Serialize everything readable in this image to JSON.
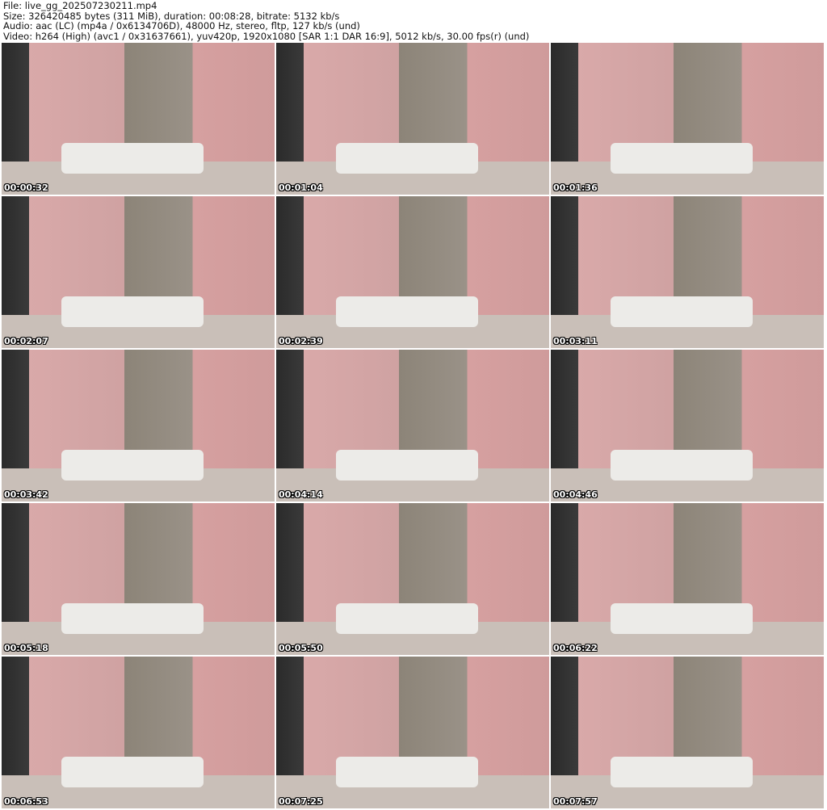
{
  "header": {
    "file": "File: live_gg_202507230211.mp4",
    "size": "Size: 326420485 bytes (311 MiB), duration: 00:08:28, bitrate: 5132 kb/s",
    "audio": "Audio: aac (LC) (mp4a / 0x6134706D), 48000 Hz, stereo, fltp, 127 kb/s (und)",
    "video": "Video: h264 (High) (avc1 / 0x31637661), yuv420p, 1920x1080 [SAR 1:1 DAR 16:9], 5012 kb/s, 30.00 fps(r) (und)"
  },
  "thumbnails": [
    "00:00:32",
    "00:01:04",
    "00:01:36",
    "00:02:07",
    "00:02:39",
    "00:03:11",
    "00:03:42",
    "00:04:14",
    "00:04:46",
    "00:05:18",
    "00:05:50",
    "00:06:22",
    "00:06:53",
    "00:07:25",
    "00:07:57"
  ]
}
